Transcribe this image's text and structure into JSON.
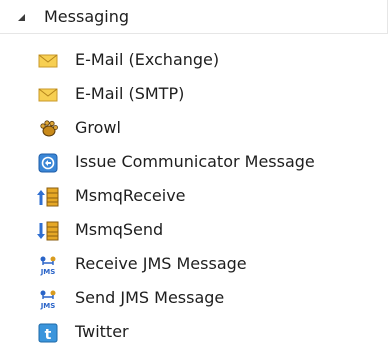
{
  "group": {
    "title": "Messaging",
    "expanded": true
  },
  "items": [
    {
      "label": "E-Mail (Exchange)",
      "icon": "envelope-icon"
    },
    {
      "label": "E-Mail (SMTP)",
      "icon": "envelope-icon"
    },
    {
      "label": "Growl",
      "icon": "growl-paw-icon"
    },
    {
      "label": "Issue Communicator Message",
      "icon": "communicator-icon"
    },
    {
      "label": "MsmqReceive",
      "icon": "msmq-receive-icon"
    },
    {
      "label": "MsmqSend",
      "icon": "msmq-send-icon"
    },
    {
      "label": "Receive JMS Message",
      "icon": "jms-icon"
    },
    {
      "label": "Send JMS Message",
      "icon": "jms-icon"
    },
    {
      "label": "Twitter",
      "icon": "twitter-icon"
    }
  ],
  "colors": {
    "text": "#1e1e1e",
    "envelope": "#f5c53d",
    "communicator": "#2f7fd0",
    "msmq_arrow": "#2f6fd1",
    "msmq_gold": "#e0a020",
    "jms": "#2a64c8",
    "twitter": "#2f8fd8"
  }
}
